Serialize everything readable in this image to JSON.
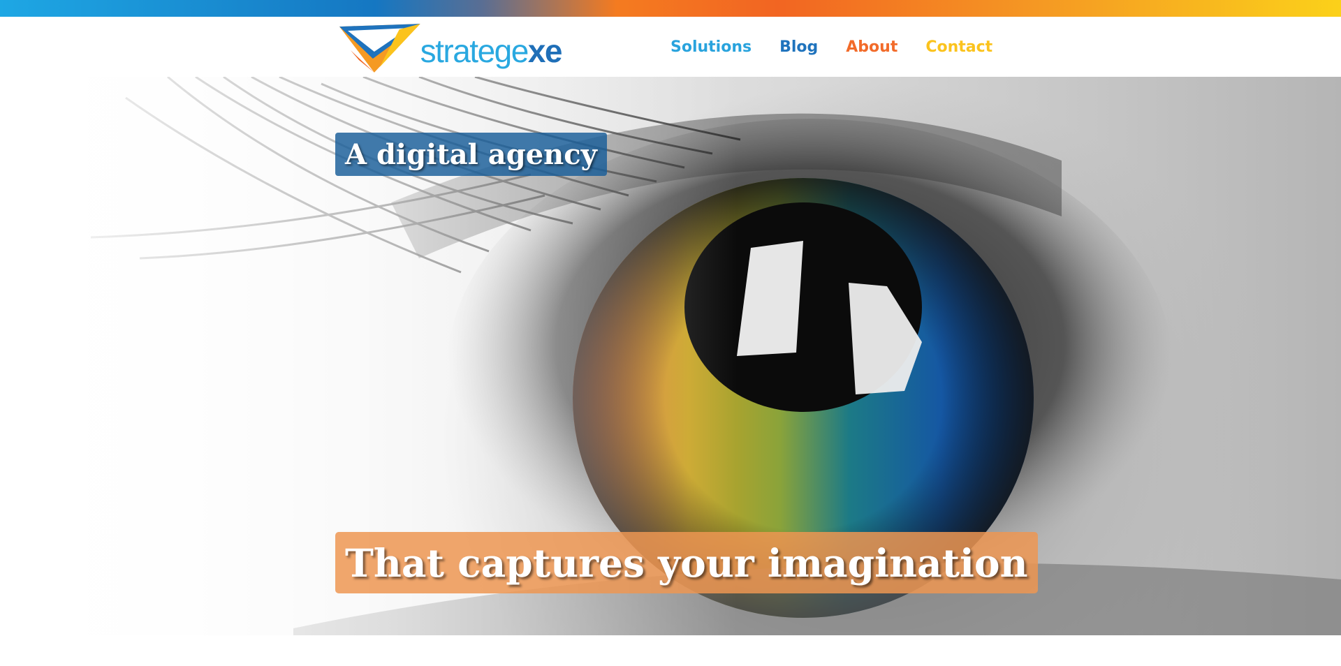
{
  "brand": {
    "name_part1": "strategexe_primary",
    "logo_text_light": "stratege",
    "logo_text_bold": "xe",
    "colors": {
      "light_blue": "#29a8e0",
      "dark_blue": "#1f6fb8",
      "orange": "#f26b2a",
      "yellow": "#fbc31d"
    }
  },
  "nav": {
    "items": [
      {
        "label": "Solutions",
        "color": "#29a3dd"
      },
      {
        "label": "Blog",
        "color": "#1f73bd"
      },
      {
        "label": "About",
        "color": "#f26b2a"
      },
      {
        "label": "Contact",
        "color": "#fbc31d"
      }
    ]
  },
  "hero": {
    "caption_small": "A digital agency",
    "caption_big": "That captures your imagination",
    "image_icon": "eye-photo"
  }
}
